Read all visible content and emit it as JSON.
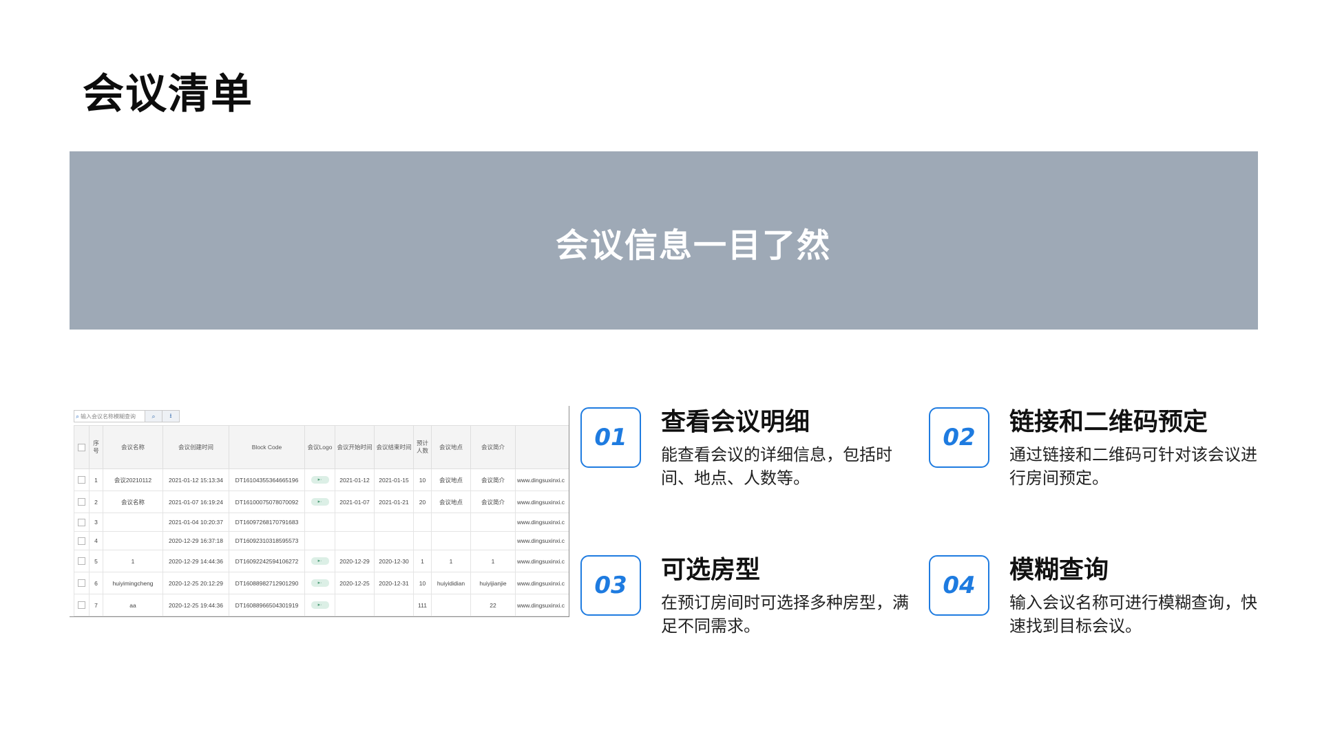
{
  "page": {
    "title": "会议清单"
  },
  "banner": {
    "text": "会议信息一目了然"
  },
  "screenshot": {
    "search_placeholder": "输入会议名称模糊查询",
    "search_icon": "search-icon",
    "export_icon": "download-icon",
    "headers": [
      "序号",
      "会议名称",
      "会议创建时间",
      "Block Code",
      "会议Logo",
      "会议开始时间",
      "会议结束时间",
      "预计人数",
      "会议地点",
      "会议简介",
      ""
    ],
    "rows": [
      [
        "1",
        "会议20210112",
        "2021-01-12 15:13:34",
        "DT16104355364665196",
        "logo",
        "2021-01-12",
        "2021-01-15",
        "10",
        "会议地点",
        "会议简介",
        "www.dingsuxinxi.c"
      ],
      [
        "2",
        "会议名称",
        "2021-01-07 16:19:24",
        "DT16100075078070092",
        "logo",
        "2021-01-07",
        "2021-01-21",
        "20",
        "会议地点",
        "会议简介",
        "www.dingsuxinxi.c"
      ],
      [
        "3",
        "",
        "2021-01-04 10:20:37",
        "DT16097268170791683",
        "",
        "",
        "",
        "",
        "",
        "",
        "www.dingsuxinxi.c"
      ],
      [
        "4",
        "",
        "2020-12-29 16:37:18",
        "DT16092310318595573",
        "",
        "",
        "",
        "",
        "",
        "",
        "www.dingsuxinxi.c"
      ],
      [
        "5",
        "1",
        "2020-12-29 14:44:36",
        "DT16092242594106272",
        "logo",
        "2020-12-29",
        "2020-12-30",
        "1",
        "1",
        "1",
        "www.dingsuxinxi.c"
      ],
      [
        "6",
        "huiyimingcheng",
        "2020-12-25 20:12:29",
        "DT16088982712901290",
        "logo",
        "2020-12-25",
        "2020-12-31",
        "10",
        "huiyididian",
        "huiyijianjie",
        "www.dingsuxinxi.c"
      ],
      [
        "7",
        "aa",
        "2020-12-25 19:44:36",
        "DT16088966504301919",
        "logo",
        "",
        "",
        "111",
        "",
        "22",
        "www.dingsuxinxi.c"
      ]
    ]
  },
  "features": [
    {
      "num": "01",
      "title": "查看会议明细",
      "desc": "能查看会议的详细信息，包括时间、地点、人数等。"
    },
    {
      "num": "02",
      "title": "链接和二维码预定",
      "desc": "通过链接和二维码可针对该会议进行房间预定。"
    },
    {
      "num": "03",
      "title": "可选房型",
      "desc": "在预订房间时可选择多种房型，满足不同需求。"
    },
    {
      "num": "04",
      "title": "模糊查询",
      "desc": "输入会议名称可进行模糊查询，快速找到目标会议。"
    }
  ],
  "colors": {
    "accent": "#1e7be0",
    "banner_bg": "#9ea9b6",
    "banner_text": "#ffffff"
  }
}
